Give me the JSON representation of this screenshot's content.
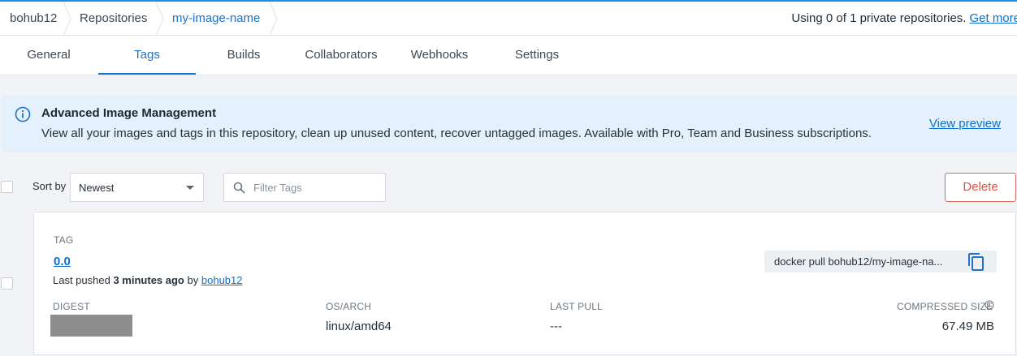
{
  "breadcrumb": {
    "items": [
      "bohub12",
      "Repositories",
      "my-image-name"
    ]
  },
  "usage": {
    "text": "Using 0 of 1 private repositories.",
    "link": "Get more"
  },
  "tabs": [
    {
      "label": "General",
      "active": false
    },
    {
      "label": "Tags",
      "active": true
    },
    {
      "label": "Builds",
      "active": false
    },
    {
      "label": "Collaborators",
      "active": false
    },
    {
      "label": "Webhooks",
      "active": false
    },
    {
      "label": "Settings",
      "active": false
    }
  ],
  "banner": {
    "icon": "info-icon",
    "title": "Advanced Image Management",
    "text": "View all your images and tags in this repository, clean up unused content, recover untagged images. Available with Pro, Team and Business subscriptions.",
    "link": "View preview"
  },
  "controls": {
    "sort_label": "Sort by",
    "sort_value": "Newest",
    "filter_placeholder": "Filter Tags",
    "delete_label": "Delete"
  },
  "tag_card": {
    "tag_header": "TAG",
    "tag_name": "0.0",
    "pushed_prefix": "Last pushed",
    "pushed_time": "3 minutes ago",
    "pushed_by": "by",
    "pushed_user": "bohub12",
    "pull_command": "docker pull bohub12/my-image-na...",
    "columns": {
      "digest": "DIGEST",
      "os_arch": "OS/ARCH",
      "last_pull": "LAST PULL",
      "compressed_size": "COMPRESSED SIZE"
    },
    "values": {
      "os_arch": "linux/amd64",
      "last_pull": "---",
      "compressed_size": "67.49 MB"
    }
  },
  "colors": {
    "accent": "#1d72c9",
    "link": "#0b6fd3",
    "banner_bg": "#e4f0fb",
    "delete": "#d9574a"
  }
}
